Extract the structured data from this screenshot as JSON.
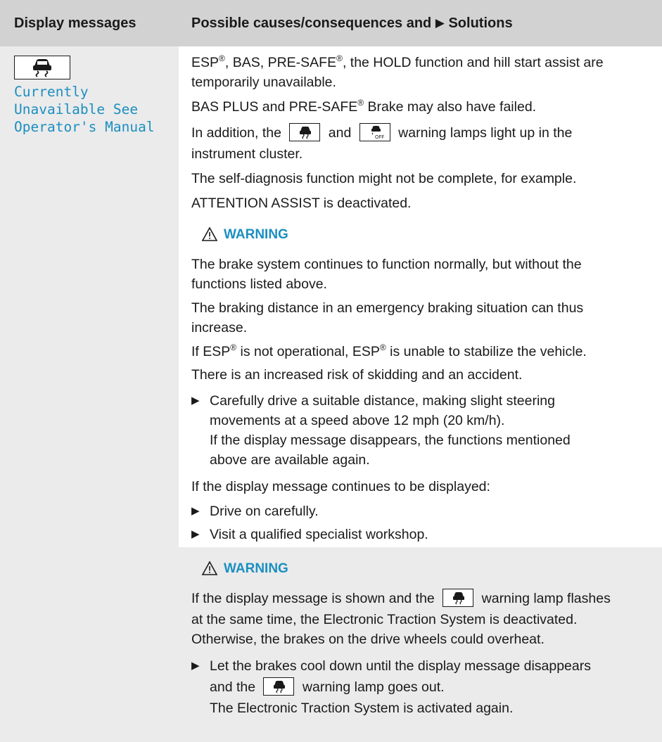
{
  "header": {
    "col1": "Display messages",
    "col2_pre": "Possible causes/consequences and",
    "col2_triangle": "▶",
    "col2_post": "Solutions"
  },
  "message": {
    "icon": "skidding-car-icon",
    "line1": "Currently",
    "line2": "Unavailable See",
    "line3": "Operator's Manual"
  },
  "paragraphs": {
    "p1a_1": "ESP",
    "reg": "®",
    "p1a_2": ", BAS, PRE-SAFE",
    "p1a_3": ", the HOLD function and hill start assist are",
    "p1b": "temporarily unavailable.",
    "p2a": "BAS PLUS and PRE-SAFE",
    "p2b": " Brake may also have failed.",
    "p3a_1": "In addition, the",
    "p3a_2": "and",
    "p3a_3": "warning lamps light up in the",
    "p3b": "instrument cluster.",
    "p4": "The self-diagnosis function might not be complete, for example.",
    "p5": "ATTENTION ASSIST is deactivated."
  },
  "warning1": {
    "title": "WARNING",
    "l1": "The brake system continues to function normally, but without the",
    "l2": "functions listed above.",
    "l3": "The braking distance in an emergency braking situation can thus",
    "l4": "increase.",
    "l5a": "If ESP",
    "l5b": " is not operational, ESP",
    "l5c": " is unable to stabilize the vehicle.",
    "l6": "There is an increased risk of skidding and an accident."
  },
  "steps": {
    "bullet": "▶",
    "s1a": "Carefully drive a suitable distance, making slight steering",
    "s1b": "movements at a speed above 12 mph (20 km/h).",
    "s1c": "If the display message disappears, the functions mentioned",
    "s1d": "above are available again.",
    "cont": "If the display message continues to be displayed:",
    "s2": "Drive on carefully.",
    "s3": "Visit a qualified specialist workshop."
  },
  "warning2": {
    "title": "WARNING",
    "l1a": "If the display message is shown and the",
    "l1b": "warning lamp flashes",
    "l2": "at the same time, the Electronic Traction System is deactivated.",
    "l3": "Otherwise, the brakes on the drive wheels could overheat.",
    "s1a": "Let the brakes cool down until the display message disappears",
    "s1b_1": "and the",
    "s1b_2": "warning lamp goes out.",
    "s1c": "The Electronic Traction System is activated again."
  },
  "colors": {
    "accent": "#1b8fc1",
    "header_bg": "#d2d2d2",
    "panel_bg": "#ebebeb"
  }
}
